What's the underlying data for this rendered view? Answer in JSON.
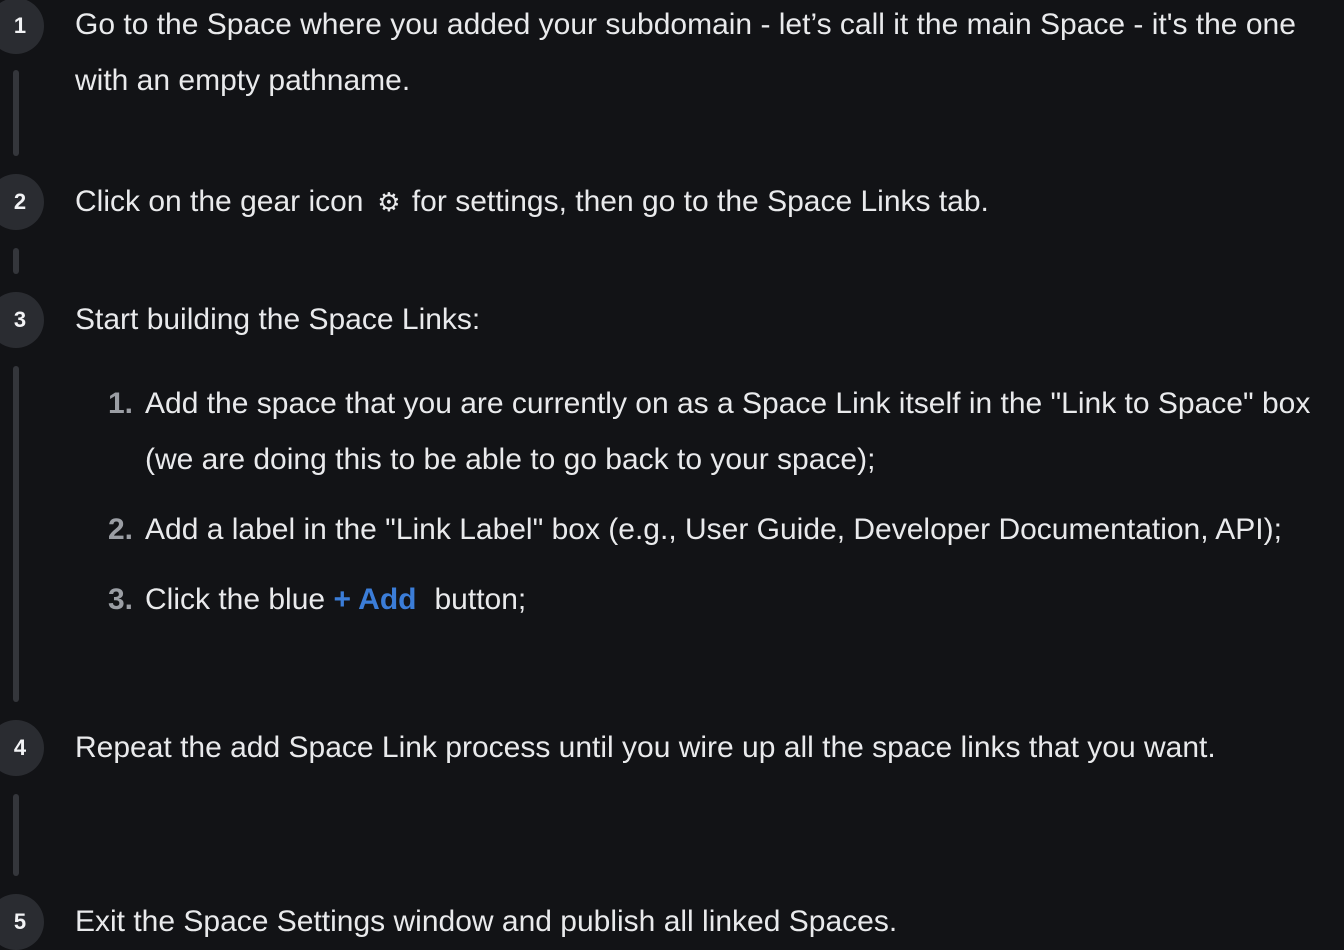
{
  "steps": [
    {
      "number": "1",
      "text": "Go to the Space where you added your subdomain - let’s call it the main Space - it's the one with an empty pathname."
    },
    {
      "number": "2",
      "text_before": "Click on the gear icon",
      "icon": "gear-icon",
      "text_after": "for settings, then go to the Space Links tab."
    },
    {
      "number": "3",
      "text": "Start building the Space Links:",
      "substeps": [
        {
          "number": "1.",
          "text": "Add the space that you are currently on as a Space Link itself in the \"Link to Space\" box (we are doing this to be able to go back to your space);"
        },
        {
          "number": "2.",
          "text": "Add a label in the \"Link Label\" box (e.g., User Guide, Developer Documentation, API);"
        },
        {
          "number": "3.",
          "text_before": "Click the blue",
          "button_label": "+ Add",
          "text_after": "button;"
        }
      ]
    },
    {
      "number": "4",
      "text": "Repeat the add Space Link process until you wire up all the space links that you want."
    },
    {
      "number": "5",
      "text": "Exit the Space Settings window and publish all linked Spaces."
    }
  ],
  "colors": {
    "background": "#121316",
    "text": "#e9eaec",
    "badge": "#2a2c31",
    "accent": "#3b7dd8"
  }
}
